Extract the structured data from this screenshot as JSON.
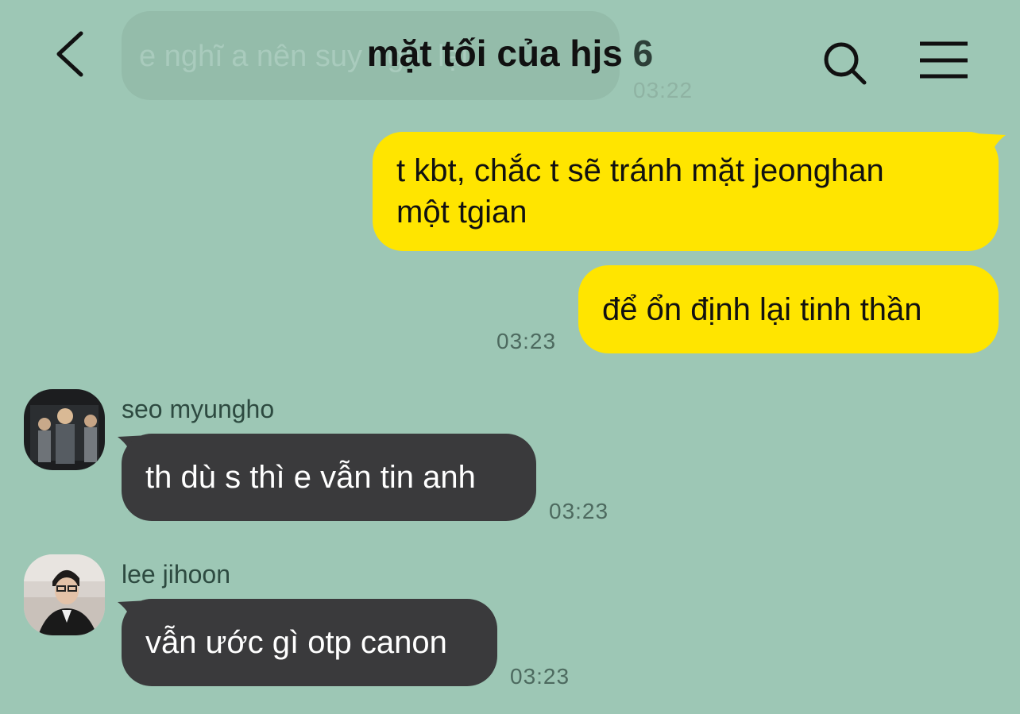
{
  "header": {
    "title": "mặt tối của hjs",
    "member_count": "6"
  },
  "previous_message": {
    "text": "e nghĩ a nên suy nghĩ lại",
    "time": "03:22"
  },
  "messages": [
    {
      "sender": "me",
      "lines": [
        "t kbt, chắc t sẽ tránh mặt jeonghan",
        "một tgian"
      ],
      "time": ""
    },
    {
      "sender": "me",
      "text": "để ổn định lại tinh thần",
      "time": "03:23"
    },
    {
      "sender": "seo myungho",
      "text": "th dù s thì e vẫn tin anh",
      "time": "03:23"
    },
    {
      "sender": "lee jihoon",
      "text": "vẫn ước gì otp canon",
      "time": "03:23"
    }
  ],
  "colors": {
    "background": "#9dc7b5",
    "my_bubble": "#ffe500",
    "their_bubble": "#3a3a3c"
  }
}
